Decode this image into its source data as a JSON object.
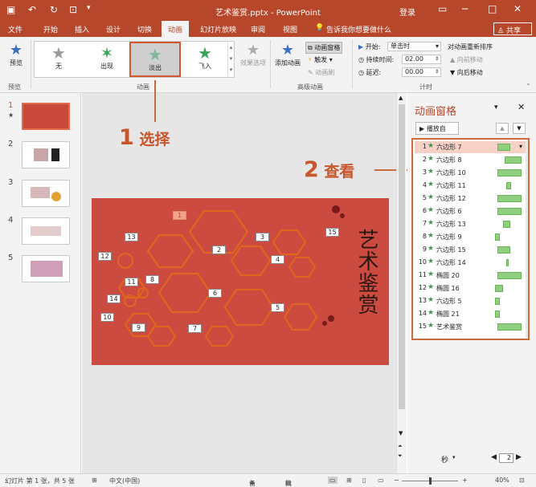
{
  "window": {
    "title": "艺术鉴赏.pptx - PowerPoint",
    "login": "登录",
    "controls": [
      "─",
      "□",
      "✕"
    ]
  },
  "tabs": [
    "文件",
    "开始",
    "插入",
    "设计",
    "切换",
    "动画",
    "幻灯片放映",
    "审阅",
    "视图"
  ],
  "active_tab": "动画",
  "tell_me": "告诉我你想要做什么",
  "share": "共享",
  "ribbon": {
    "preview_label": "预览",
    "group_preview": "预览",
    "group_animation": "动画",
    "group_advanced": "高级动画",
    "group_timing": "计时",
    "gallery": [
      {
        "label": "无",
        "icon": "star-gray-icon"
      },
      {
        "label": "出现",
        "icon": "star-green-burst-icon"
      },
      {
        "label": "淡出",
        "icon": "star-faded-icon"
      },
      {
        "label": "飞入",
        "icon": "star-fly-icon"
      }
    ],
    "selected_effect": "淡出",
    "effect_options": "效果选项",
    "add_animation": "添加动画",
    "animation_pane": "动画窗格",
    "trigger": "触发",
    "animation_painter": "动画刷",
    "start_label": "开始:",
    "start_value": "单击时",
    "duration_label": "持续时间:",
    "duration_value": "02.00",
    "delay_label": "延迟:",
    "delay_value": "00.00",
    "reorder_title": "对动画重新排序",
    "move_earlier": "向前移动",
    "move_later": "向后移动"
  },
  "thumbnails": [
    "1",
    "2",
    "3",
    "4",
    "5"
  ],
  "slide": {
    "title_vertical": "艺术鉴赏",
    "tags": [
      "1",
      "2",
      "3",
      "4",
      "5",
      "6",
      "7",
      "8",
      "9",
      "10",
      "11",
      "12",
      "13",
      "14",
      "15"
    ]
  },
  "pane": {
    "title": "动画窗格",
    "play_button": "播放自",
    "items": [
      {
        "num": "1",
        "label": "六边形 7"
      },
      {
        "num": "2",
        "label": "六边形 8"
      },
      {
        "num": "3",
        "label": "六边形 10"
      },
      {
        "num": "4",
        "label": "六边形 11"
      },
      {
        "num": "5",
        "label": "六边形 12"
      },
      {
        "num": "6",
        "label": "六边形 6"
      },
      {
        "num": "7",
        "label": "六边形 13"
      },
      {
        "num": "8",
        "label": "六边形 9"
      },
      {
        "num": "9",
        "label": "六边形 15"
      },
      {
        "num": "10",
        "label": "六边形 14"
      },
      {
        "num": "11",
        "label": "椭圆 20"
      },
      {
        "num": "12",
        "label": "椭圆 16"
      },
      {
        "num": "13",
        "label": "六边形 5"
      },
      {
        "num": "14",
        "label": "椭圆 21"
      },
      {
        "num": "15",
        "label": "艺术鉴赏"
      }
    ],
    "seconds_label": "秒",
    "timeline_value": "2"
  },
  "annotations": {
    "step1_num": "1",
    "step1_text": "选择",
    "step2_num": "2",
    "step2_text": "查看"
  },
  "status": {
    "slide_info": "幻灯片 第 1 张，共 5 张",
    "language": "中文(中国)",
    "notes": "备注",
    "comments": "批注",
    "zoom": "40%"
  },
  "colors": {
    "accent": "#b7472a",
    "slide_bg": "#cc4b41",
    "callout": "#c8562c",
    "bar_green": "#8fd07e"
  }
}
